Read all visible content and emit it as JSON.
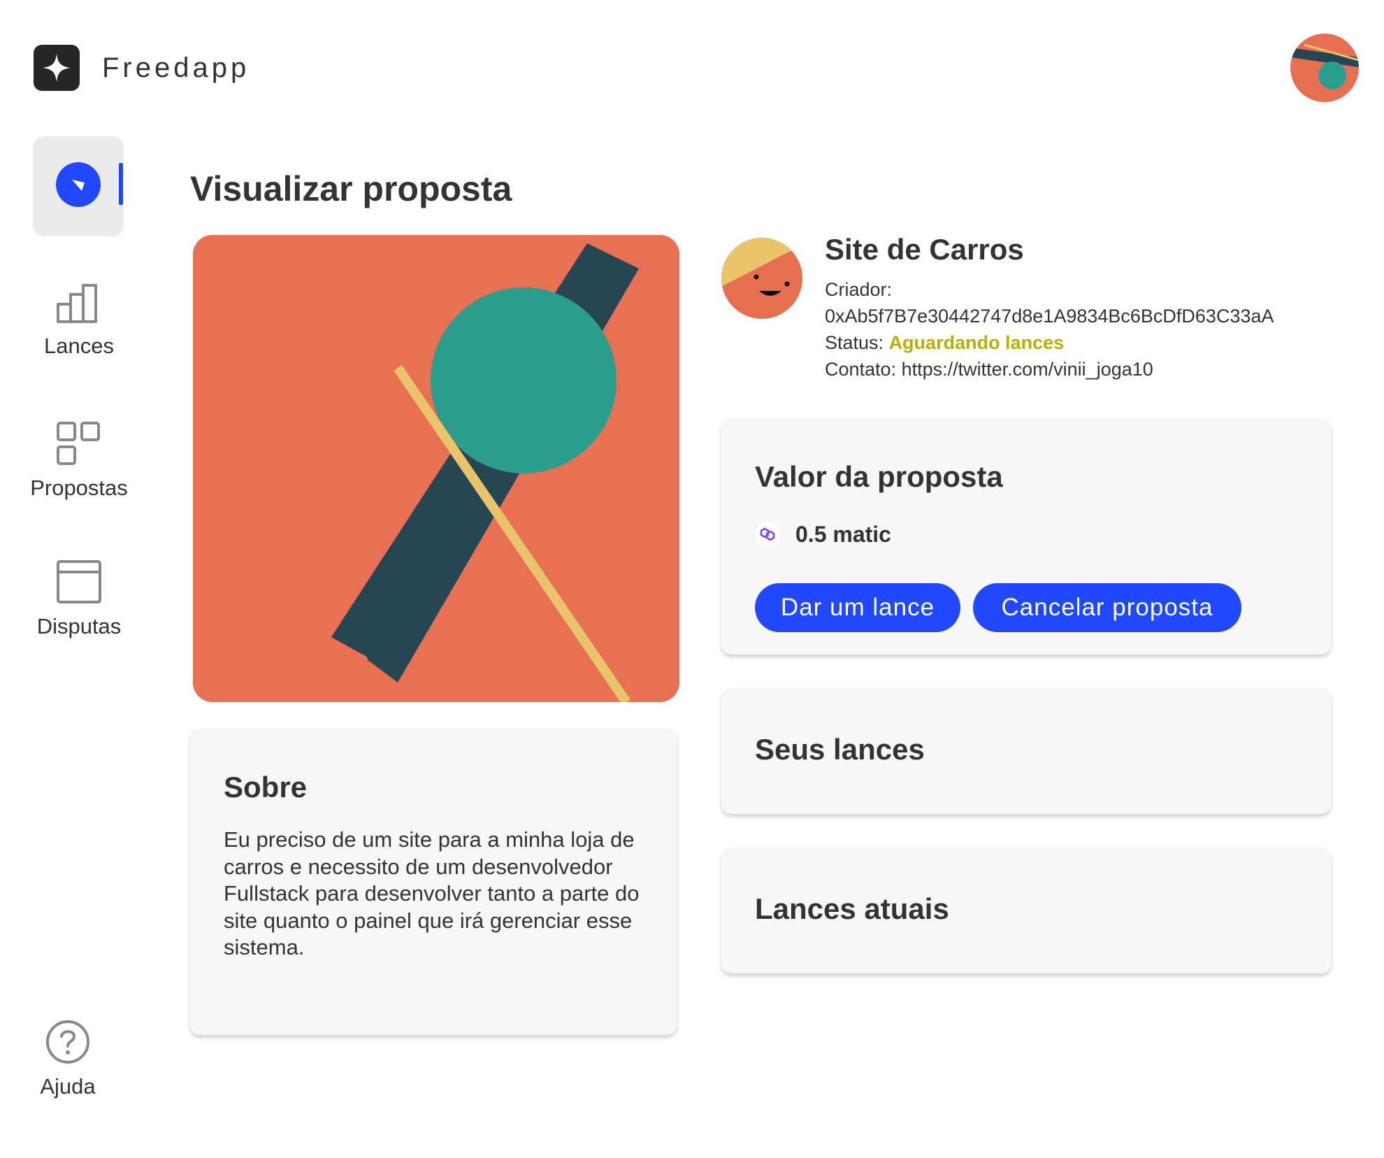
{
  "app": {
    "name": "Freedapp"
  },
  "sidebar": {
    "items": [
      {
        "label": "Lances",
        "icon": "bar-chart-icon"
      },
      {
        "label": "Propostas",
        "icon": "grid-icon"
      },
      {
        "label": "Disputas",
        "icon": "browser-window-icon"
      }
    ],
    "active_icon": "compass-icon",
    "help": {
      "label": "Ajuda",
      "icon": "help-circle-icon"
    }
  },
  "page": {
    "title": "Visualizar proposta"
  },
  "proposal": {
    "title": "Site de Carros",
    "creator_label": "Criador:",
    "creator_address": "0xAb5f7B7e30442747d8e1A9834Bc6BcDfD63C33aA",
    "status_label": "Status:",
    "status_value": "Aguardando lances",
    "contact_label": "Contato:",
    "contact_value": "https://twitter.com/vinii_joga10"
  },
  "about": {
    "heading": "Sobre",
    "text": "Eu preciso de um site para a minha loja de carros e necessito de um desenvolvedor Fullstack para desenvolver tanto a parte do site quanto o painel que irá gerenciar esse sistema."
  },
  "value": {
    "heading": "Valor da proposta",
    "amount": "0.5 matic",
    "bid_button": "Dar um lance",
    "cancel_button": "Cancelar proposta"
  },
  "your_bids": {
    "heading": "Seus lances"
  },
  "current_bids": {
    "heading": "Lances atuais"
  },
  "colors": {
    "accent": "#2148ff",
    "status": "#b6b000",
    "hero_bg": "#e87053",
    "hero_teal": "#2b9d8c",
    "hero_dark": "#264653",
    "hero_yellow": "#e9c46a"
  }
}
